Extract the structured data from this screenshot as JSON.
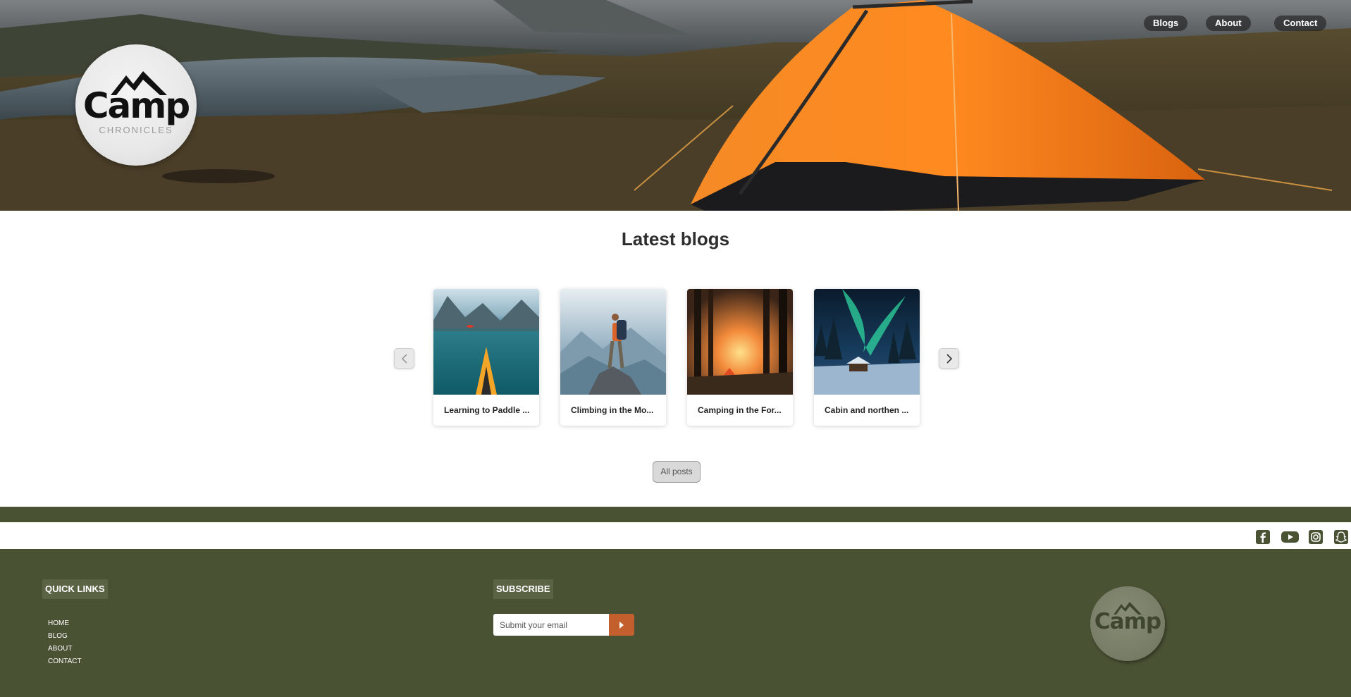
{
  "header": {
    "logo": {
      "word": "Camp",
      "sub": "CHRONICLES"
    },
    "nav": [
      {
        "label": "Blogs"
      },
      {
        "label": "About"
      },
      {
        "label": "Contact"
      }
    ]
  },
  "main": {
    "title": "Latest blogs",
    "cards": [
      {
        "title": "Learning to Paddle ..."
      },
      {
        "title": "Climbing in the Mo..."
      },
      {
        "title": "Camping in the For..."
      },
      {
        "title": "Cabin and northen ..."
      }
    ],
    "all_posts_label": "All posts"
  },
  "footer": {
    "quick_links_title": "QUICK LINKS",
    "links": [
      "HOME",
      "BLOG",
      "ABOUT",
      "CONTACT"
    ],
    "subscribe_title": "SUBSCRIBE",
    "email_placeholder": "Submit your email",
    "logo_word": "Camp",
    "social": [
      "facebook-icon",
      "youtube-icon",
      "instagram-icon",
      "snapchat-icon"
    ]
  },
  "colors": {
    "footer_green": "#4a5234",
    "subscribe_orange": "#c25f2c",
    "tent_orange": "#f07a1a"
  }
}
